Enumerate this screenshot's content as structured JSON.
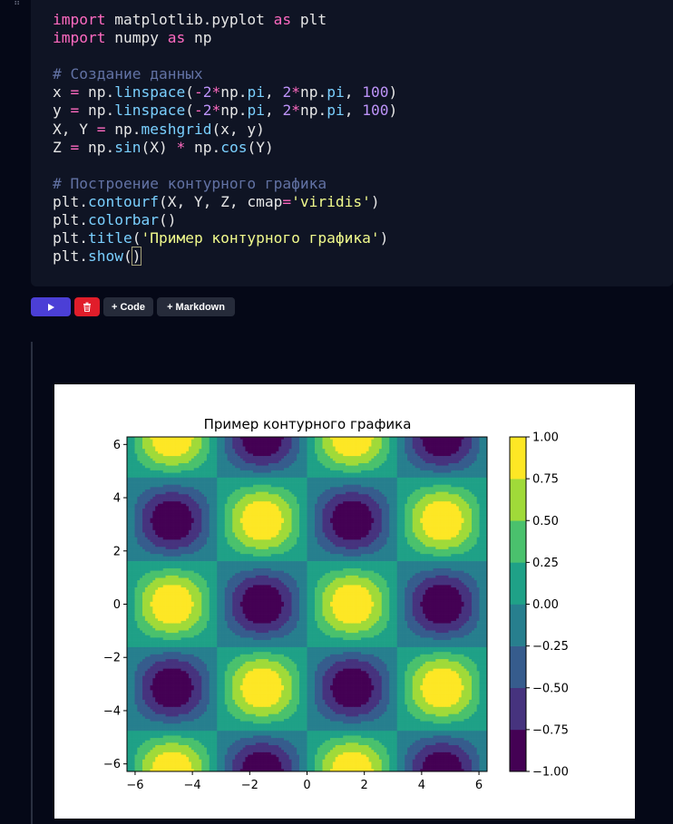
{
  "code_cell": {
    "lines": [
      [
        {
          "t": "import",
          "c": "kw"
        },
        {
          "t": " matplotlib.pyplot "
        },
        {
          "t": "as",
          "c": "kw"
        },
        {
          "t": " plt"
        }
      ],
      [
        {
          "t": "import",
          "c": "kw"
        },
        {
          "t": " numpy "
        },
        {
          "t": "as",
          "c": "kw"
        },
        {
          "t": " np"
        }
      ],
      [],
      [
        {
          "t": "# Создание данных",
          "c": "com"
        }
      ],
      [
        {
          "t": "x "
        },
        {
          "t": "=",
          "c": "op"
        },
        {
          "t": " np."
        },
        {
          "t": "linspace",
          "c": "fn"
        },
        {
          "t": "("
        },
        {
          "t": "-",
          "c": "op"
        },
        {
          "t": "2",
          "c": "num"
        },
        {
          "t": "*",
          "c": "op"
        },
        {
          "t": "np."
        },
        {
          "t": "pi",
          "c": "fn"
        },
        {
          "t": ", "
        },
        {
          "t": "2",
          "c": "num"
        },
        {
          "t": "*",
          "c": "op"
        },
        {
          "t": "np."
        },
        {
          "t": "pi",
          "c": "fn"
        },
        {
          "t": ", "
        },
        {
          "t": "100",
          "c": "num"
        },
        {
          "t": ")"
        }
      ],
      [
        {
          "t": "y "
        },
        {
          "t": "=",
          "c": "op"
        },
        {
          "t": " np."
        },
        {
          "t": "linspace",
          "c": "fn"
        },
        {
          "t": "("
        },
        {
          "t": "-",
          "c": "op"
        },
        {
          "t": "2",
          "c": "num"
        },
        {
          "t": "*",
          "c": "op"
        },
        {
          "t": "np."
        },
        {
          "t": "pi",
          "c": "fn"
        },
        {
          "t": ", "
        },
        {
          "t": "2",
          "c": "num"
        },
        {
          "t": "*",
          "c": "op"
        },
        {
          "t": "np."
        },
        {
          "t": "pi",
          "c": "fn"
        },
        {
          "t": ", "
        },
        {
          "t": "100",
          "c": "num"
        },
        {
          "t": ")"
        }
      ],
      [
        {
          "t": "X, Y "
        },
        {
          "t": "=",
          "c": "op"
        },
        {
          "t": " np."
        },
        {
          "t": "meshgrid",
          "c": "fn"
        },
        {
          "t": "(x, y)"
        }
      ],
      [
        {
          "t": "Z "
        },
        {
          "t": "=",
          "c": "op"
        },
        {
          "t": " np."
        },
        {
          "t": "sin",
          "c": "fn"
        },
        {
          "t": "(X) "
        },
        {
          "t": "*",
          "c": "op"
        },
        {
          "t": " np."
        },
        {
          "t": "cos",
          "c": "fn"
        },
        {
          "t": "(Y)"
        }
      ],
      [],
      [
        {
          "t": "# Построение контурного графика",
          "c": "com"
        }
      ],
      [
        {
          "t": "plt."
        },
        {
          "t": "contourf",
          "c": "fn"
        },
        {
          "t": "(X, Y, Z, cmap"
        },
        {
          "t": "=",
          "c": "op"
        },
        {
          "t": "'viridis'",
          "c": "str"
        },
        {
          "t": ")"
        }
      ],
      [
        {
          "t": "plt."
        },
        {
          "t": "colorbar",
          "c": "fn"
        },
        {
          "t": "()"
        }
      ],
      [
        {
          "t": "plt."
        },
        {
          "t": "title",
          "c": "fn"
        },
        {
          "t": "("
        },
        {
          "t": "'Пример контурного графика'",
          "c": "str"
        },
        {
          "t": ")"
        }
      ],
      [
        {
          "t": "plt."
        },
        {
          "t": "show",
          "c": "fn"
        },
        {
          "t": "("
        },
        {
          "t": ")",
          "c": "cursor-bracket"
        }
      ]
    ]
  },
  "toolbar": {
    "run_icon": "play-icon",
    "delete_icon": "trash-icon",
    "add_code_label": "+ Code",
    "add_markdown_label": "+ Markdown"
  },
  "chart_data": {
    "type": "heatmap",
    "function": "sin(x) * cos(y)",
    "title": "Пример контурного графика",
    "xlabel": "",
    "ylabel": "",
    "xlim": [
      -6.283,
      6.283
    ],
    "ylim": [
      -6.283,
      6.283
    ],
    "x_ticks": [
      -6,
      -4,
      -2,
      0,
      2,
      4,
      6
    ],
    "y_ticks": [
      -6,
      -4,
      -2,
      0,
      2,
      4,
      6
    ],
    "x_tick_labels": [
      "−6",
      "−4",
      "−2",
      "0",
      "2",
      "4",
      "6"
    ],
    "y_tick_labels": [
      "−6",
      "−4",
      "−2",
      "0",
      "2",
      "4",
      "6"
    ],
    "levels": [
      -1.0,
      -0.75,
      -0.5,
      -0.25,
      0.0,
      0.25,
      0.5,
      0.75,
      1.0
    ],
    "level_labels": [
      "−1.00",
      "−0.75",
      "−0.50",
      "−0.25",
      "0.00",
      "0.25",
      "0.50",
      "0.75",
      "1.00"
    ],
    "colormap": "viridis",
    "band_colors": [
      "#440154",
      "#46337e",
      "#365c8d",
      "#277f8e",
      "#1fa187",
      "#4ac16d",
      "#a0da39",
      "#fde725"
    ],
    "colorbar": true,
    "grid": false,
    "legend": "none"
  }
}
